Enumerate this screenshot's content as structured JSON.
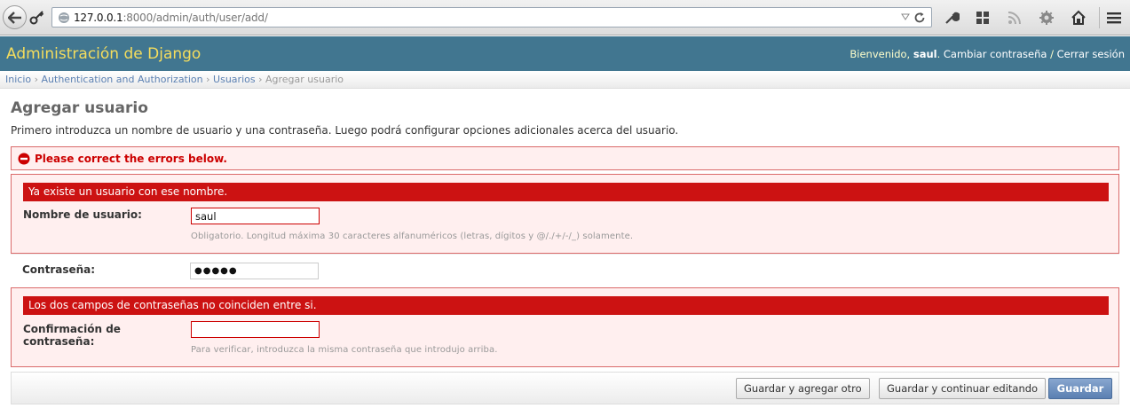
{
  "browser": {
    "url_host": "127.0.0.1",
    "url_rest": ":8000/admin/auth/user/add/"
  },
  "header": {
    "brand": "Administración de Django",
    "welcome": "Bienvenido, ",
    "username": "saul",
    "change_password": "Cambiar contraseña",
    "separator": " / ",
    "logout": "Cerrar sesión"
  },
  "breadcrumbs": {
    "home": "Inicio",
    "app": "Authentication and Authorization",
    "model": "Usuarios",
    "current": "Agregar usuario",
    "sep": " › "
  },
  "page": {
    "title": "Agregar usuario",
    "intro": "Primero introduzca un nombre de usuario y una contraseña. Luego podrá configurar opciones adicionales acerca del usuario.",
    "errornote": "Please correct the errors below."
  },
  "form": {
    "username": {
      "error": "Ya existe un usuario con ese nombre.",
      "label": "Nombre de usuario:",
      "value": "saul",
      "help": "Obligatorio. Longitud máxima 30 caracteres alfanuméricos (letras, dígitos y @/./+/-/_) solamente."
    },
    "password1": {
      "label": "Contraseña:",
      "value": "●●●●●"
    },
    "password2": {
      "error": "Los dos campos de contraseñas no coinciden entre si.",
      "label_line1": "Confirmación de",
      "label_line2": "contraseña:",
      "value": "",
      "help": "Para verificar, introduzca la misma contraseña que introdujo arriba."
    }
  },
  "buttons": {
    "save_add": "Guardar y agregar otro",
    "save_continue": "Guardar y continuar editando",
    "save": "Guardar"
  },
  "colors": {
    "header_bg": "#417690",
    "brand": "#f5dd5d",
    "error_bg": "#cc1212",
    "link": "#5b80b2"
  }
}
